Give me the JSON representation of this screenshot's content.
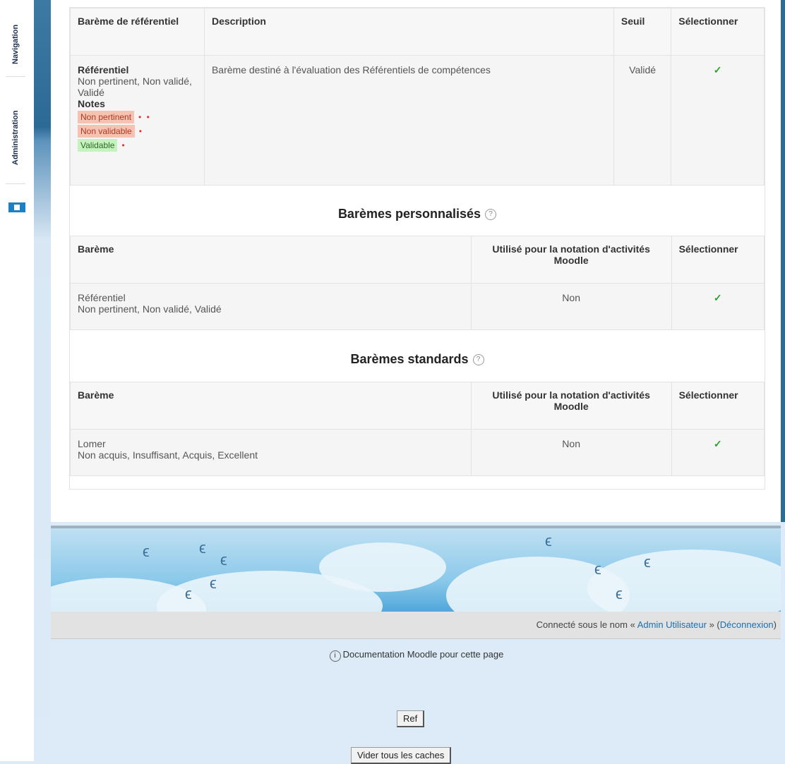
{
  "dock": {
    "navigation": "Navigation",
    "administration": "Administration"
  },
  "ref_table": {
    "headers": {
      "scale": "Barème de référentiel",
      "description": "Description",
      "threshold": "Seuil",
      "select": "Sélectionner"
    },
    "row": {
      "name": "Référentiel",
      "values": "Non pertinent, Non validé, Validé",
      "notes_label": "Notes",
      "tags": [
        {
          "label": "Non pertinent",
          "dots": "• •"
        },
        {
          "label": "Non validable",
          "dots": "•"
        },
        {
          "label": "Validable",
          "dots": "•"
        }
      ],
      "description": "Barème destiné à l'évaluation des Référentiels de compétences",
      "threshold": "Validé",
      "select": "✓"
    }
  },
  "custom": {
    "heading": "Barèmes personnalisés",
    "headers": {
      "scale": "Barème",
      "used": "Utilisé pour la notation d'activités Moodle",
      "select": "Sélectionner"
    },
    "row": {
      "name": "Référentiel",
      "values": "Non pertinent, Non validé, Validé",
      "used": "Non",
      "select": "✓"
    }
  },
  "standard": {
    "heading": "Barèmes standards",
    "headers": {
      "scale": "Barème",
      "used": "Utilisé pour la notation d'activités Moodle",
      "select": "Sélectionner"
    },
    "row": {
      "name": "Lomer",
      "values": "Non acquis, Insuffisant, Acquis, Excellent",
      "used": "Non",
      "select": "✓"
    }
  },
  "help_icon": "?",
  "footer": {
    "login_prefix": "Connecté sous le nom « ",
    "user": "Admin Utilisateur",
    "login_mid": " » (",
    "logout": "Déconnexion",
    "login_suffix": ")",
    "doc_info": "i",
    "doc_link": "Documentation Moodle pour cette page",
    "btn_ref": "Ref",
    "btn_cache": "Vider tous les caches"
  },
  "colors": {
    "check": "#2ea02e",
    "tag_red": "#f6c2b4",
    "tag_green": "#c6f2c0"
  }
}
